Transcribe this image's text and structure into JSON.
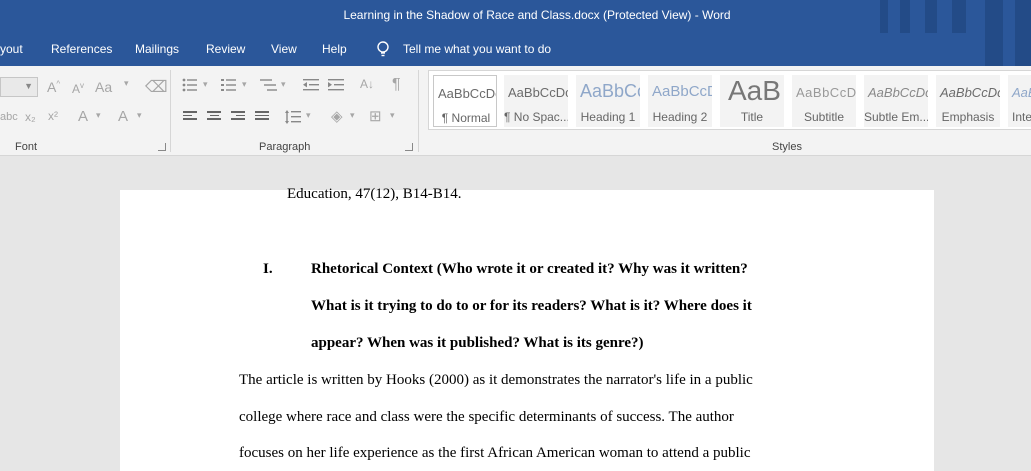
{
  "window": {
    "title": "Learning in the Shadow of Race and Class.docx (Protected View)  -  Word"
  },
  "menu": {
    "items": [
      "yout",
      "References",
      "Mailings",
      "Review",
      "View",
      "Help"
    ],
    "tell_me": "Tell me what you want to do"
  },
  "ribbon": {
    "groups": {
      "font": "Font",
      "paragraph": "Paragraph",
      "styles": "Styles"
    },
    "font_buttons": {
      "grow": "A",
      "grow_sup": "^",
      "shrink": "A",
      "shrink_sup": "v",
      "abc": "abc",
      "sub": "x₂",
      "sup": "x²",
      "text_effects": "A",
      "font_color": "A"
    },
    "paragraph_buttons": {
      "sort": "A↓",
      "pilcrow": "¶"
    }
  },
  "styles": [
    {
      "preview": "AaBbCcDc",
      "name": "¶ Normal"
    },
    {
      "preview": "AaBbCcDc",
      "name": "¶ No Spac..."
    },
    {
      "preview": "AaBbCc",
      "name": "Heading 1"
    },
    {
      "preview": "AaBbCcD",
      "name": "Heading 2"
    },
    {
      "preview": "AaB",
      "name": "Title"
    },
    {
      "preview": "AaBbCcD",
      "name": "Subtitle"
    },
    {
      "preview": "AaBbCcDc",
      "name": "Subtle Em..."
    },
    {
      "preview": "AaBbCcDc",
      "name": "Emphasis"
    },
    {
      "preview": "AaBb",
      "name": "Inte"
    }
  ],
  "document": {
    "ref_line": "Education, 47(12), B14-B14.",
    "heading_numeral": "I.",
    "heading_lines": [
      "Rhetorical Context (Who wrote it or created it? Why was it written?",
      "What is it trying to do to or for its readers? What is it? Where does it",
      "appear? When was it published? What is its genre?)"
    ],
    "body_lines": [
      "The article is written by Hooks (2000) as it demonstrates the narrator's life in a public",
      "college where race and class were the specific determinants of success. The author",
      "focuses on her life experience as the first African American woman to attend a public"
    ]
  }
}
